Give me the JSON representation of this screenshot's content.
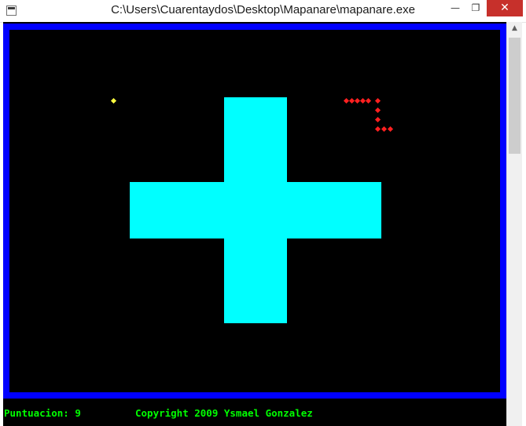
{
  "window": {
    "title": "C:\\Users\\Cuarentaydos\\Desktop\\Mapanare\\mapanare.exe",
    "minimize_glyph": "—",
    "maximize_glyph": "❐",
    "close_glyph": "✕"
  },
  "game": {
    "colors": {
      "border": "#0000ff",
      "background": "#000000",
      "wall": "#00ffff",
      "snake": "#ff2020",
      "food": "#ffff40",
      "status_text": "#00ff00"
    },
    "status": {
      "score_label": "Puntuacion:",
      "score": "9",
      "copyright": "Copyright 2009 Ysmael Gonzalez"
    }
  }
}
